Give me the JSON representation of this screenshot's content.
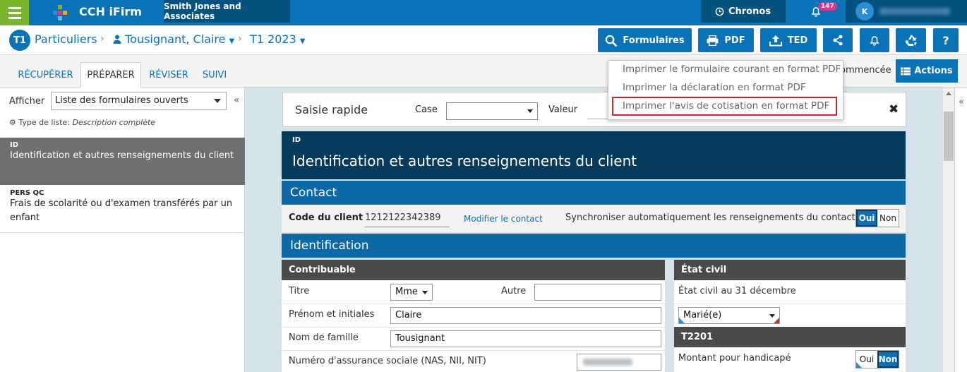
{
  "topbar": {
    "app_title": "CCH iFirm",
    "firm_name": "Smith Jones and Associates",
    "chronos_label": "Chronos",
    "notification_count": "147",
    "user_initial": "K",
    "brand_color": "#0a72b7",
    "menu_color": "#7ab52d"
  },
  "breadcrumb": {
    "module_icon": "T1",
    "module": "Particuliers",
    "client": "Tousignant, Claire",
    "year": "T1 2023"
  },
  "toolbar": {
    "formulaires": "Formulaires",
    "pdf": "PDF",
    "ted": "TED"
  },
  "pdf_menu": {
    "items": [
      "Imprimer le formulaire courant en format PDF",
      "Imprimer la déclaration en format PDF",
      "Imprimer l'avis de cotisation en format PDF"
    ]
  },
  "tabs": [
    "RÉCUPÉRER",
    "PRÉPARER",
    "RÉVISER",
    "SUIVI"
  ],
  "status_text": "ommencée",
  "actions_label": "Actions",
  "left_panel": {
    "show_label": "Afficher",
    "list_value": "Liste des formulaires ouverts",
    "type_label": "Type de liste:",
    "type_value": "Description complète",
    "forms": [
      {
        "code": "ID",
        "desc": "Identification et autres renseignements du client"
      },
      {
        "code": "PERS QC",
        "desc": "Frais de scolarité ou d'examen transférés par un enfant"
      }
    ]
  },
  "quick_entry": {
    "title": "Saisie rapide",
    "case_label": "Case",
    "value_label": "Valeur"
  },
  "form": {
    "code": "ID",
    "title": "Identification et autres renseignements du client",
    "contact_section": "Contact",
    "client_code_label": "Code du client",
    "client_code_value": "1212122342389",
    "modify_contact": "Modifier le contact",
    "sync_label": "Synchroniser automatiquement les renseignements du contact",
    "yes": "Oui",
    "no": "Non",
    "identification_section": "Identification",
    "taxpayer_header": "Contribuable",
    "title_label": "Titre",
    "title_value": "Mme",
    "other_label": "Autre",
    "first_name_label": "Prénom et initiales",
    "first_name_value": "Claire",
    "last_name_label": "Nom de famille",
    "last_name_value": "Tousignant",
    "sin_label": "Numéro d'assurance sociale (NAS, NII, NIT)",
    "civil_header": "État civil",
    "civil_dec_label": "État civil au 31 décembre",
    "civil_value": "Marié(e)",
    "t2201_header": "T2201",
    "disability_label": "Montant pour handicapé"
  }
}
